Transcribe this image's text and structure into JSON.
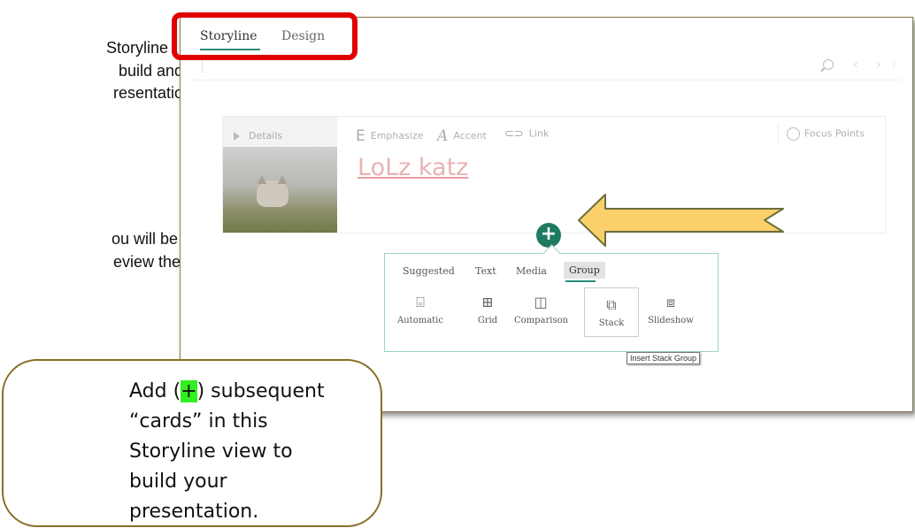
{
  "background_text": [
    "Storyline",
    "build and",
    "resentation.",
    "ou will be",
    "eview the"
  ],
  "tabs": {
    "storyline": "Storyline",
    "design": "Design"
  },
  "card": {
    "details_label": "Details",
    "toolbar": {
      "emphasize_glyph": "E",
      "emphasize": "Emphasize",
      "accent_glyph": "A",
      "accent": "Accent",
      "link": "Link"
    },
    "focus_points": "Focus Points",
    "title": "LoLz katz"
  },
  "add_button": "+",
  "group_panel": {
    "tabs": [
      "Suggested",
      "Text",
      "Media",
      "Group"
    ],
    "options": [
      "Automatic",
      "Grid",
      "Comparison",
      "Stack",
      "Slideshow"
    ],
    "selected_option": "Stack",
    "tooltip": "Insert Stack Group"
  },
  "callout": {
    "prefix": "Add (",
    "plus": "+",
    "line1_rest": ") subsequent",
    "line2": "“cards” in this",
    "line3": "Storyline view to",
    "line4": "build your",
    "line5": "presentation."
  },
  "colors": {
    "accent": "#1f7a62",
    "highlight_box": "#e00000",
    "arrow_fill": "#fbd06b",
    "callout_border": "#8a6e25",
    "plus_highlight": "#33ee22"
  }
}
